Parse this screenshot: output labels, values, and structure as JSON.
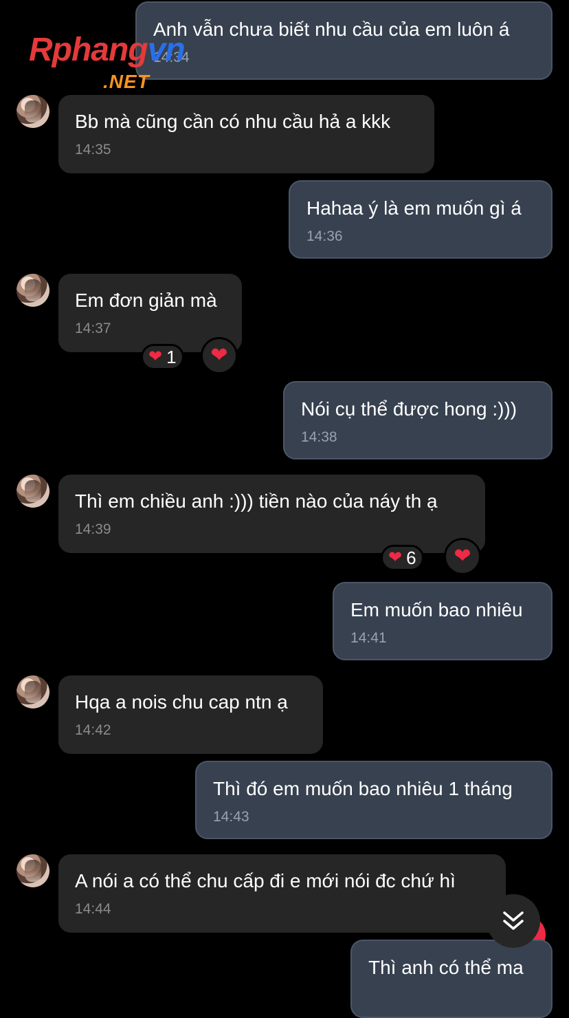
{
  "watermark": {
    "part1": "Rphang",
    "part2": "vn",
    "net": ".NET"
  },
  "messages": [
    {
      "text": "Anh vẫn chưa biết nhu cầu của em luôn á",
      "time": "14:34"
    },
    {
      "text": "Bb mà cũng cần có nhu cầu hả a kkk",
      "time": "14:35"
    },
    {
      "text": "Hahaa ý là em muốn gì á",
      "time": "14:36"
    },
    {
      "text": "Em đơn giản mà",
      "time": "14:37",
      "reaction_count": "1"
    },
    {
      "text": "Nói cụ thể được hong :)))",
      "time": "14:38"
    },
    {
      "text": "Thì em chiều anh :))) tiền nào của náy th ạ",
      "time": "14:39",
      "reaction_count": "6"
    },
    {
      "text": "Em muốn bao nhiêu",
      "time": "14:41"
    },
    {
      "text": "Hqa a nois chu cap ntn ạ",
      "time": "14:42"
    },
    {
      "text": "Thì đó em muốn bao nhiêu 1 tháng",
      "time": "14:43"
    },
    {
      "text": "A nói a có thể chu cấp đi e mới nói đc chứ hì",
      "time": "14:44"
    },
    {
      "text": "Thì anh có thể ma"
    }
  ],
  "icons": {
    "heart": "heart-icon",
    "scroll": "double-chevron-down-icon"
  },
  "colors": {
    "outgoing": "#374150",
    "incoming": "#262626",
    "heart": "#ef2a45"
  }
}
